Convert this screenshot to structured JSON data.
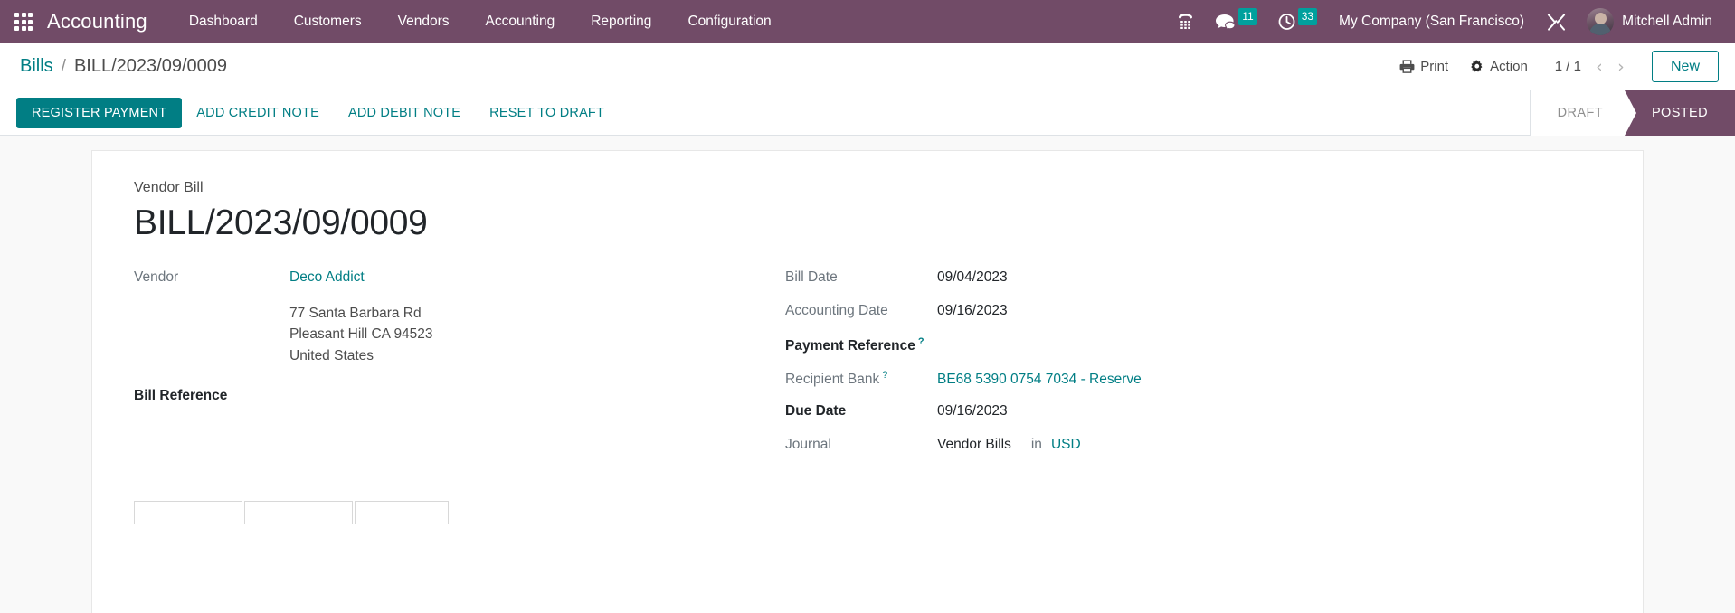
{
  "navbar": {
    "apps_icon": "apps-grid-icon",
    "brand": "Accounting",
    "menu": [
      {
        "label": "Dashboard"
      },
      {
        "label": "Customers"
      },
      {
        "label": "Vendors"
      },
      {
        "label": "Accounting"
      },
      {
        "label": "Reporting"
      },
      {
        "label": "Configuration"
      }
    ],
    "voip_icon": "phone-dialpad-icon",
    "messages_icon": "messages-bubble-icon",
    "messages_count": "11",
    "activities_icon": "clock-activities-icon",
    "activities_count": "33",
    "company": "My Company (San Francisco)",
    "debug_icon": "tools-wrench-icon",
    "avatar_icon": "user-avatar",
    "user": "Mitchell Admin",
    "bg_color": "#714b67",
    "badge_color": "#00a09d"
  },
  "control_panel": {
    "breadcrumb_root": "Bills",
    "breadcrumb_sep": "/",
    "breadcrumb_current": "BILL/2023/09/0009",
    "print_icon": "printer-icon",
    "print_label": "Print",
    "action_icon": "gear-icon",
    "action_label": "Action",
    "pager_value": "1 / 1",
    "prev_icon": "chevron-left-icon",
    "next_icon": "chevron-right-icon",
    "new_label": "New",
    "accent_color": "#017e84"
  },
  "statusbar": {
    "buttons": [
      {
        "label": "REGISTER PAYMENT",
        "primary": true
      },
      {
        "label": "ADD CREDIT NOTE",
        "primary": false
      },
      {
        "label": "ADD DEBIT NOTE",
        "primary": false
      },
      {
        "label": "RESET TO DRAFT",
        "primary": false
      }
    ],
    "stages": [
      {
        "label": "DRAFT",
        "active": false
      },
      {
        "label": "POSTED",
        "active": true
      }
    ]
  },
  "form": {
    "doc_type": "Vendor Bill",
    "doc_title": "BILL/2023/09/0009",
    "left": {
      "vendor_label": "Vendor",
      "vendor_value": "Deco Addict",
      "address": [
        "77 Santa Barbara Rd",
        "Pleasant Hill CA 94523",
        "United States"
      ],
      "bill_reference_label": "Bill Reference",
      "bill_reference_value": ""
    },
    "right": {
      "bill_date_label": "Bill Date",
      "bill_date_value": "09/04/2023",
      "accounting_date_label": "Accounting Date",
      "accounting_date_value": "09/16/2023",
      "payment_reference_label": "Payment Reference",
      "payment_reference_help": "?",
      "payment_reference_value": "",
      "recipient_bank_label": "Recipient Bank",
      "recipient_bank_help": "?",
      "recipient_bank_value": "BE68 5390 0754 7034 - Reserve",
      "due_date_label": "Due Date",
      "due_date_value": "09/16/2023",
      "journal_label": "Journal",
      "journal_value": "Vendor Bills",
      "journal_in": "in",
      "currency_value": "USD"
    }
  }
}
